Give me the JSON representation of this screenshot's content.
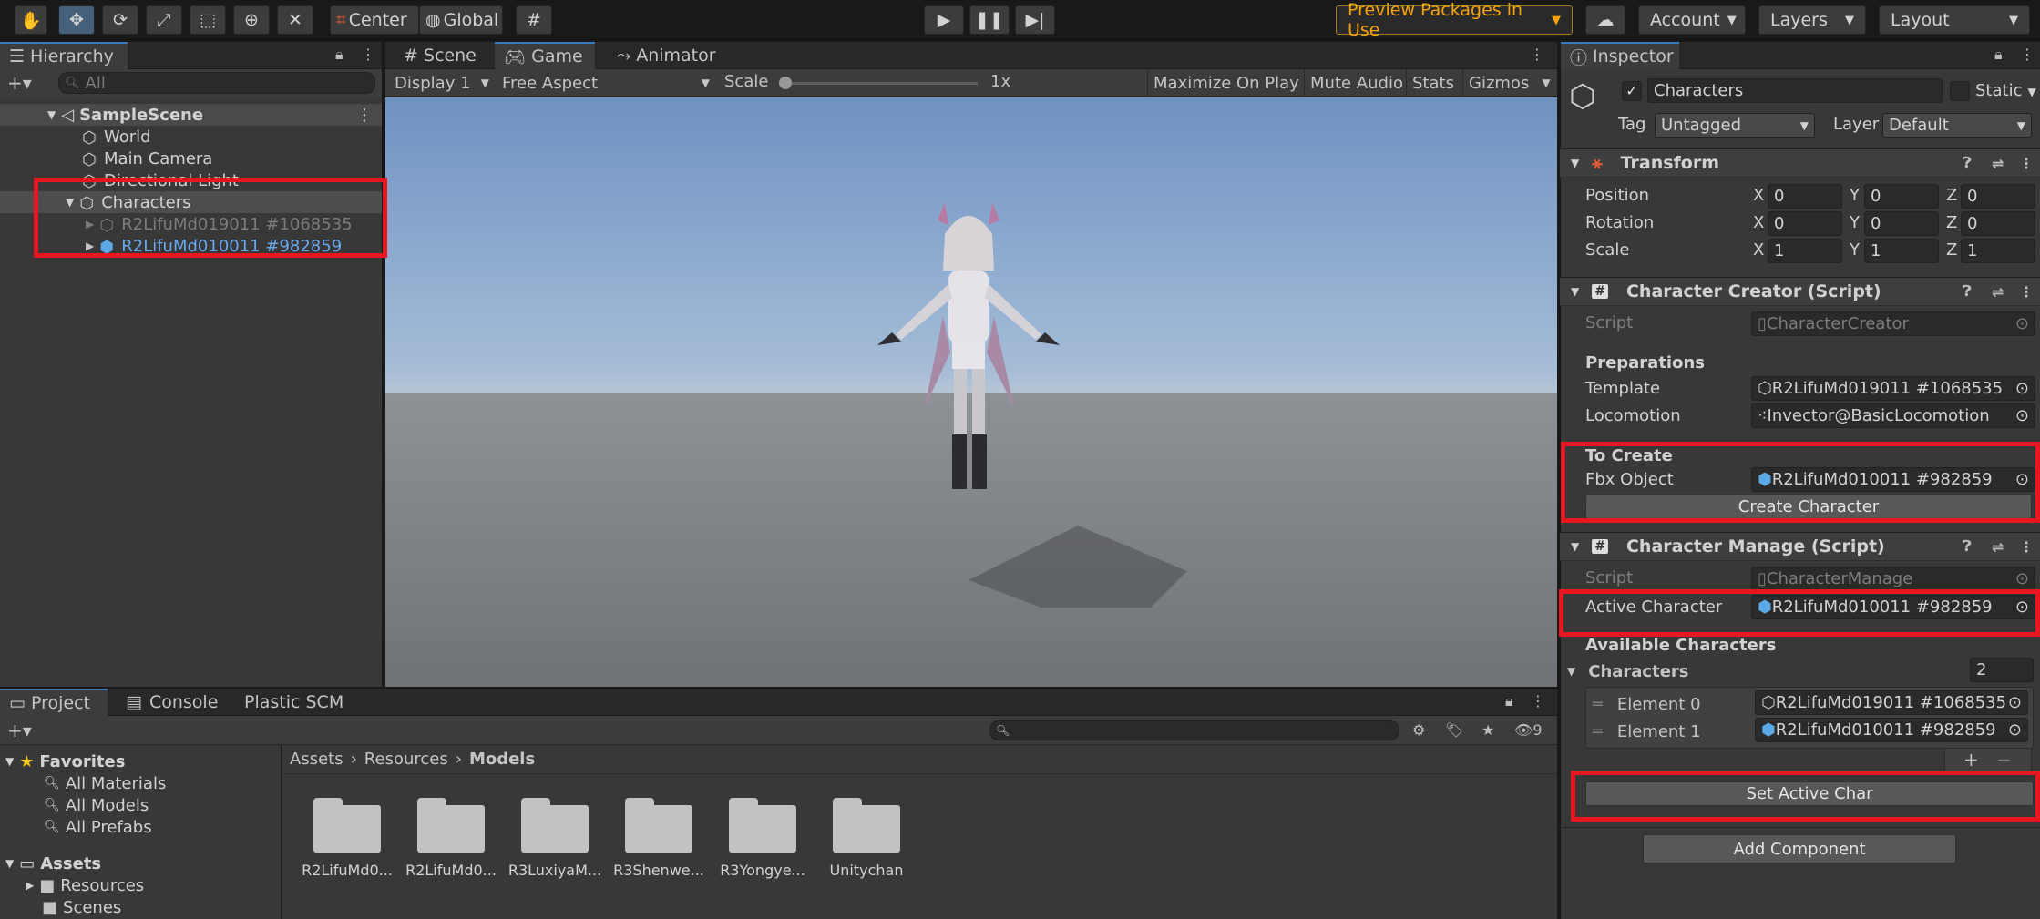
{
  "toolbar": {
    "center_label": "Center",
    "global_label": "Global",
    "preview_packages": "Preview Packages in Use",
    "account": "Account",
    "layers": "Layers",
    "layout": "Layout"
  },
  "hierarchy": {
    "tab": "Hierarchy",
    "search_placeholder": "All",
    "scene": "SampleScene",
    "items": [
      "World",
      "Main Camera",
      "Directional Light",
      "Characters"
    ],
    "children": [
      "R2LifuMd019011 #1068535",
      "R2LifuMd010011 #982859"
    ]
  },
  "scene_tabs": {
    "scene": "Scene",
    "game": "Game",
    "animator": "Animator"
  },
  "game_bar": {
    "display": "Display 1",
    "aspect": "Free Aspect",
    "scale_label": "Scale",
    "scale_value": "1x",
    "maximize": "Maximize On Play",
    "mute": "Mute Audio",
    "stats": "Stats",
    "gizmos": "Gizmos"
  },
  "project": {
    "tabs": [
      "Project",
      "Console",
      "Plastic SCM"
    ],
    "favorites": "Favorites",
    "fav_items": [
      "All Materials",
      "All Models",
      "All Prefabs"
    ],
    "assets": "Assets",
    "asset_items": [
      "Resources",
      "Scenes"
    ],
    "breadcrumb": [
      "Assets",
      "Resources",
      "Models"
    ],
    "hidden_count": "9",
    "folders": [
      "R2LifuMd0...",
      "R2LifuMd0...",
      "R3LuxiyaM...",
      "R3Shenwe...",
      "R3Yongye...",
      "Unitychan"
    ]
  },
  "inspector": {
    "tab": "Inspector",
    "object_name": "Characters",
    "static_label": "Static",
    "tag_label": "Tag",
    "tag_value": "Untagged",
    "layer_label": "Layer",
    "layer_value": "Default",
    "transform": {
      "title": "Transform",
      "rows": [
        {
          "label": "Position",
          "x": "0",
          "y": "0",
          "z": "0"
        },
        {
          "label": "Rotation",
          "x": "0",
          "y": "0",
          "z": "0"
        },
        {
          "label": "Scale",
          "x": "1",
          "y": "1",
          "z": "1"
        }
      ],
      "axis": [
        "X",
        "Y",
        "Z"
      ]
    },
    "creator": {
      "title": "Character Creator (Script)",
      "script_label": "Script",
      "script_value": "CharacterCreator",
      "preparations": "Preparations",
      "template_label": "Template",
      "template_value": "R2LifuMd019011 #1068535",
      "locomotion_label": "Locomotion",
      "locomotion_value": "Invector@BasicLocomotion",
      "to_create": "To Create",
      "fbx_label": "Fbx Object",
      "fbx_value": "R2LifuMd010011 #982859",
      "create_button": "Create Character"
    },
    "manage": {
      "title": "Character Manage (Script)",
      "script_label": "Script",
      "script_value": "CharacterManage",
      "active_label": "Active Character",
      "active_value": "R2LifuMd010011 #982859",
      "available": "Available Characters",
      "characters_label": "Characters",
      "characters_count": "2",
      "elements": [
        {
          "label": "Element 0",
          "value": "R2LifuMd019011 #1068535"
        },
        {
          "label": "Element 1",
          "value": "R2LifuMd010011 #982859"
        }
      ],
      "set_active_button": "Set Active Char"
    },
    "add_component": "Add Component"
  },
  "colors": {
    "highlight": "#e8171f",
    "selection": "#46607c",
    "preview_text": "#f5a20c"
  }
}
